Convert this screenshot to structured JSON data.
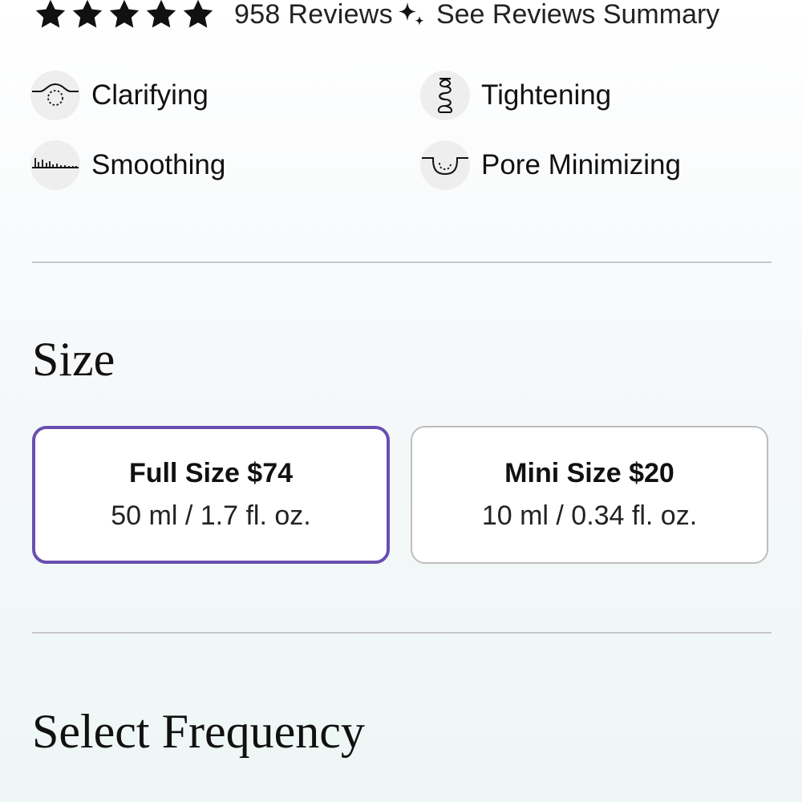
{
  "reviews": {
    "star_count": 5,
    "rating_stars_filled": 5,
    "count_label": "958 Reviews",
    "summary_icon": "sparkle-icon",
    "summary_label": "See Reviews Summary"
  },
  "benefits": [
    {
      "label": "Clarifying",
      "icon": "clarifying-icon"
    },
    {
      "label": "Tightening",
      "icon": "tightening-icon"
    },
    {
      "label": "Smoothing",
      "icon": "smoothing-icon"
    },
    {
      "label": "Pore Minimizing",
      "icon": "pore-minimizing-icon"
    }
  ],
  "size_section": {
    "title": "Size",
    "options": [
      {
        "name": "Full Size $74",
        "volume": "50 ml / 1.7 fl. oz.",
        "selected": true
      },
      {
        "name": "Mini Size $20",
        "volume": "10 ml / 0.34 fl. oz.",
        "selected": false
      }
    ]
  },
  "frequency_section": {
    "title": "Select Frequency"
  },
  "colors": {
    "accent_selected_border": "#6a4fb0",
    "divider": "#c8c8c8",
    "icon_background": "#eeeeee",
    "text": "#111111"
  }
}
